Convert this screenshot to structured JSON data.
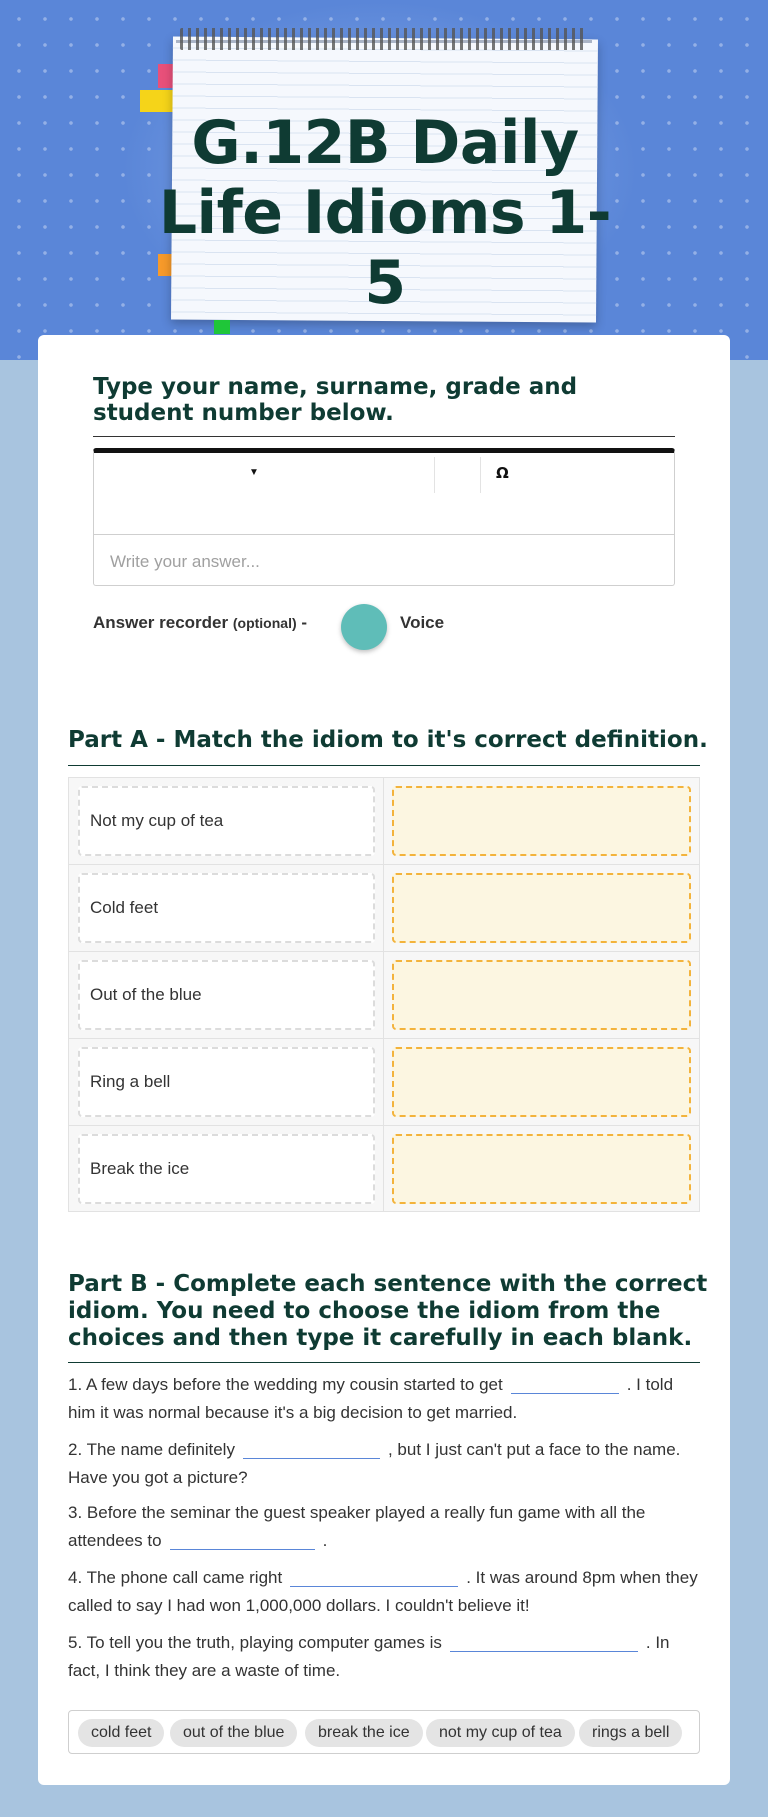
{
  "header": {
    "title": "G.12B Daily Life Idioms 1-5"
  },
  "question1": {
    "prompt": "Type your name, surname, grade and student number below.",
    "placeholder": "Write your answer...",
    "toolbar_symbol": "Ω",
    "recorder_label": "Answer recorder",
    "recorder_optional": "(optional)",
    "recorder_dash": "-",
    "recorder_mode": "Voice"
  },
  "partA": {
    "title": "Part A - Match the idiom to it's correct definition.",
    "items": [
      "Not my cup of tea",
      "Cold feet",
      "Out of the blue",
      "Ring a bell",
      "Break the ice"
    ]
  },
  "partB": {
    "title": "Part B - Complete each sentence with the correct idiom. You need to choose the idiom from the choices and then type it carefully in each blank.",
    "sentences": [
      {
        "before": "1. A few days before the wedding my cousin started to get",
        "after": ". I told him it was normal because it's a big decision to get married."
      },
      {
        "before": "2. The name definitely",
        "after": ", but I just can't put a face to the name. Have you got a picture?"
      },
      {
        "before": "3. Before the seminar the guest speaker played a really fun game with all the attendees to",
        "after": "."
      },
      {
        "before": "4. The phone call came right",
        "after": ". It was around 8pm when they called to say I had won 1,000,000 dollars. I couldn't believe it!"
      },
      {
        "before": "5. To tell you the truth, playing computer games is",
        "after": ". In fact, I think they are a waste of time."
      }
    ],
    "word_bank": [
      "cold feet",
      "out of the blue",
      "break the ice",
      "not my cup of tea",
      "rings a bell"
    ]
  },
  "colors": {
    "hero_bg": "#5a86d8",
    "page_bg": "#a8c4df",
    "title_text": "#0f3b33",
    "drop_zone_bg": "#fcf6e1",
    "drop_zone_border": "#f3b33c",
    "recorder_button": "#5fbdb8"
  }
}
